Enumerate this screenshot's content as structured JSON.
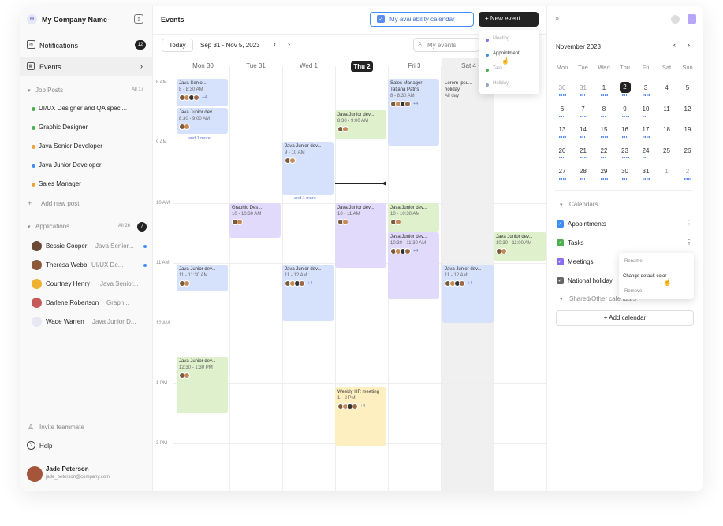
{
  "sidebar": {
    "company": "My Company Name",
    "company_initial": "M",
    "notifications": {
      "label": "Notifications",
      "count": "12"
    },
    "events": "Events",
    "job_posts": {
      "label": "Job Posts",
      "count": "All 17",
      "items": [
        {
          "label": "UI/UX Designer and QA speci...",
          "color": "#4caf50"
        },
        {
          "label": "Graphic Designer",
          "color": "#4caf50"
        },
        {
          "label": "Java Senior Developer",
          "color": "#f0a13c"
        },
        {
          "label": "Java Junior Developer",
          "color": "#3f8ef5"
        },
        {
          "label": "Sales Manager",
          "color": "#f0a13c"
        }
      ],
      "add": "Add new post"
    },
    "applications": {
      "label": "Applications",
      "count": "All 26",
      "badge": "7",
      "items": [
        {
          "name": "Bessie Cooper",
          "role": "Java Senior...",
          "unread": true
        },
        {
          "name": "Theresa Webb",
          "role": "UI/UX De...",
          "unread": true
        },
        {
          "name": "Courtney Henry",
          "role": "Java Senior...",
          "unread": false
        },
        {
          "name": "Darlene Robertson",
          "role": "Graph...",
          "unread": false
        },
        {
          "name": "Wade Warren",
          "role": "Java Junior D...",
          "unread": false
        }
      ]
    },
    "invite": "Invite teammate",
    "help": "Help",
    "user": {
      "name": "Jade Peterson",
      "email": "jade_peterson@company.com"
    }
  },
  "header": {
    "title": "Events",
    "today": "Today",
    "range": "Sep 31 - Nov 5, 2023",
    "availability": "My availability calendar",
    "new_event": "New event",
    "search_placeholder": "My events"
  },
  "dropdown": [
    "Meeting",
    "Appointment",
    "Task",
    "Holiday"
  ],
  "days": [
    {
      "label": "Mon 30"
    },
    {
      "label": "Tue 31"
    },
    {
      "label": "Wed 1"
    },
    {
      "label": "Thu 2"
    },
    {
      "label": "Fri 3"
    },
    {
      "label": "Sat 4"
    }
  ],
  "times": [
    "8 AM",
    "9 AM",
    "10 AM",
    "11 AM",
    "12 AM",
    "1 PM",
    "3 PM"
  ],
  "events": [
    {
      "title": "Java Senio...",
      "time": "8 - 8:30 AM",
      "extra": "+4",
      "color": "blue"
    },
    {
      "title": "Java Junior dev...",
      "time": "8:30 - 9:00 AM",
      "color": "blue",
      "more": "and 1 more"
    },
    {
      "title": "Java Junior dev...",
      "time": "9 - 10 AM",
      "color": "blue",
      "more": "and 1 more"
    },
    {
      "title": "Java Junior dev...",
      "time": "8:30 - 9:00 AM",
      "color": "green"
    },
    {
      "title": "Sales Manager - Tatiana Patris",
      "time": "8 - 8:30 AM",
      "extra": "+4",
      "color": "blue"
    },
    {
      "title": "Lorem Ipsu... holiday",
      "time": "All day",
      "color": "none"
    },
    {
      "title": "Graphic Des...",
      "time": "10 - 10:30 AM",
      "color": "purple"
    },
    {
      "title": "Java Junior dev...",
      "time": "10 - 11 AM",
      "color": "purple"
    },
    {
      "title": "Java Junior dev...",
      "time": "10 - 10:30 AM",
      "color": "green"
    },
    {
      "title": "Java Junior dev...",
      "time": "10:30 - 11:30 AM",
      "extra": "+4",
      "color": "purple"
    },
    {
      "title": "Java Junior dev...",
      "time": "10:30 - 11:00 AM",
      "color": "green"
    },
    {
      "title": "Java Junior dev...",
      "time": "11 - 11:30 AM",
      "color": "blue"
    },
    {
      "title": "Java Junior dev...",
      "time": "11 - 12 AM",
      "extra": "+4",
      "color": "blue"
    },
    {
      "title": "Java Junior dev...",
      "time": "11 - 12 AM",
      "extra": "+4",
      "color": "blue"
    },
    {
      "title": "Java Junior dev...",
      "time": "12:30 - 1:30 PM",
      "color": "green"
    },
    {
      "title": "Weekly HR meeting",
      "time": "1 - 2 PM",
      "extra": "+4",
      "color": "yellow"
    }
  ],
  "mini": {
    "month": "November 2023",
    "weekdays": [
      "Mon",
      "Tue",
      "Wed",
      "Thu",
      "Fri",
      "Sat",
      "Sun"
    ],
    "weeks": [
      [
        "30",
        "31",
        "1",
        "2",
        "3",
        "4",
        "5"
      ],
      [
        "6",
        "7",
        "8",
        "9",
        "10",
        "11",
        "12"
      ],
      [
        "13",
        "14",
        "15",
        "16",
        "17",
        "18",
        "19"
      ],
      [
        "20",
        "21",
        "22",
        "23",
        "24",
        "25",
        "26"
      ],
      [
        "27",
        "28",
        "29",
        "30",
        "31",
        "1",
        "2"
      ]
    ]
  },
  "calendars": {
    "label": "Calendars",
    "items": [
      {
        "label": "Appointments",
        "color": "#3f8ef5"
      },
      {
        "label": "Tasks",
        "color": "#4caf50"
      },
      {
        "label": "Meetings",
        "color": "#8a6cf0"
      },
      {
        "label": "National holiday",
        "color": "#666"
      }
    ],
    "shared": "Shared/Other calendars",
    "add": "Add calendar",
    "menu": [
      "Rename",
      "Change default color",
      "Remove"
    ]
  }
}
